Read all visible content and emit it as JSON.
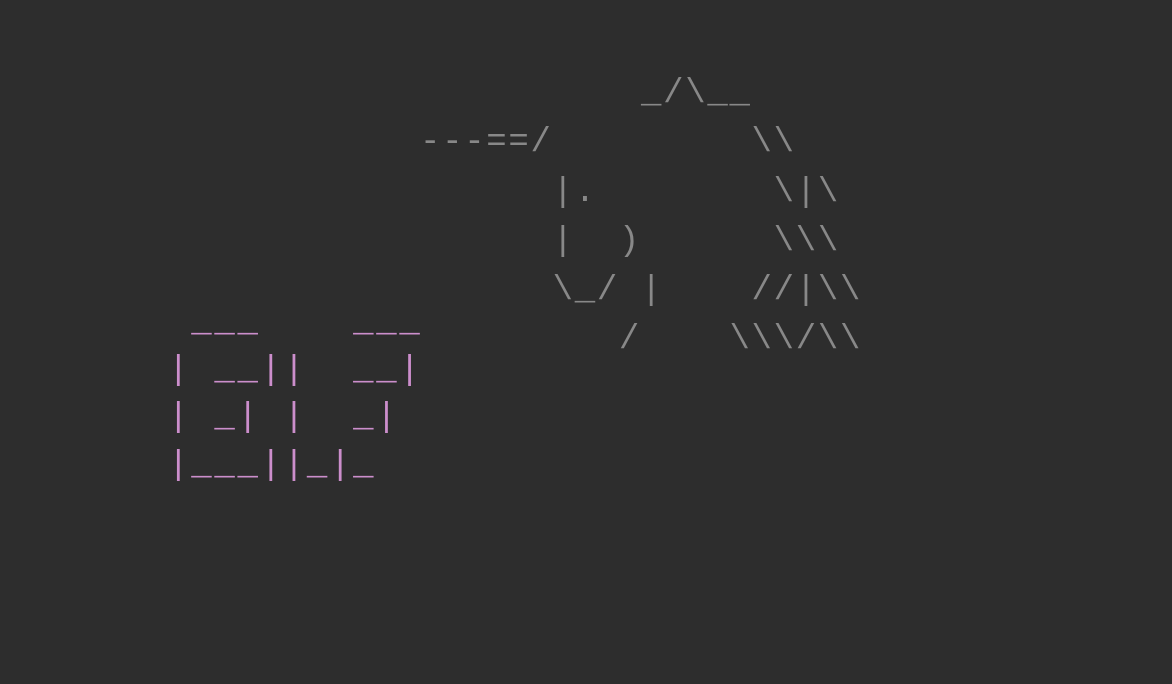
{
  "ascii_art": {
    "mountain": {
      "color": "#888888",
      "lines": [
        "          _/\\__",
        "---==/         \\\\",
        "      |.        \\|\\",
        "      |  )      \\\\\\",
        "      \\_/ |    //|\\\\",
        "         /    \\\\\\/\\\\"
      ]
    },
    "text": {
      "color": "#cc8ecc",
      "lines": [
        "  ___    ___",
        " | __||  __|",
        " | _| |  _|",
        " |___||_|_"
      ]
    }
  }
}
